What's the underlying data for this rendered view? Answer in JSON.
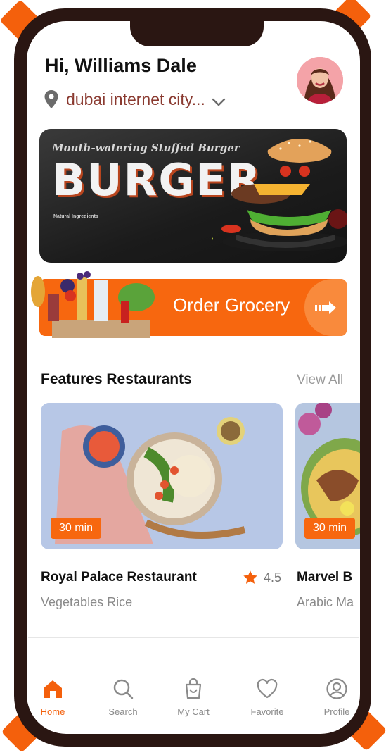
{
  "user": {
    "greeting": "Hi, Williams Dale",
    "location": "dubai internet city..."
  },
  "banner": {
    "subtitle": "Mouth-watering Stuffed Burger",
    "title": "BURGER",
    "fine_print_heading": "Natural Ingredients"
  },
  "grocery": {
    "label": "Order Grocery"
  },
  "section": {
    "title": "Features Restaurants",
    "view_all": "View All"
  },
  "restaurants": [
    {
      "name": "Royal Palace Restaurant",
      "cuisine": "Vegetables Rice",
      "time": "30 min",
      "rating": "4.5"
    },
    {
      "name": "Marvel B",
      "cuisine": "Arabic Ma",
      "time": "30 min"
    }
  ],
  "nav": [
    {
      "label": "Home",
      "icon": "home-icon",
      "active": true
    },
    {
      "label": "Search",
      "icon": "search-icon"
    },
    {
      "label": "My Cart",
      "icon": "cart-icon"
    },
    {
      "label": "Favorite",
      "icon": "heart-icon"
    },
    {
      "label": "Profile",
      "icon": "profile-icon"
    }
  ],
  "colors": {
    "accent": "#f4600c",
    "frame": "#2a1612",
    "location_text": "#8a3a30"
  }
}
